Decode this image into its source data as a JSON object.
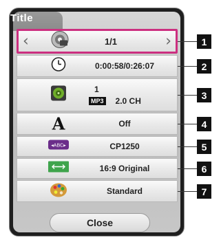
{
  "dialog": {
    "title": "Title",
    "close_label": "Close"
  },
  "rows": [
    {
      "label": "1/1",
      "icon": "disc-icon"
    },
    {
      "label": "0:00:58/0:26:07",
      "icon": "clock-icon"
    },
    {
      "line1": "1",
      "codec": "MP3",
      "line2": "2.0 CH",
      "icon": "speaker-icon"
    },
    {
      "label": "Off",
      "icon": "subtitle-icon"
    },
    {
      "label": "CP1250",
      "icon": "abc-icon"
    },
    {
      "label": "16:9 Original",
      "icon": "aspect-icon"
    },
    {
      "label": "Standard",
      "icon": "palette-icon"
    }
  ],
  "callouts": [
    "1",
    "2",
    "3",
    "4",
    "5",
    "6",
    "7"
  ],
  "colors": {
    "selection": "#cc2f80",
    "panel": "#1f1f1f"
  }
}
